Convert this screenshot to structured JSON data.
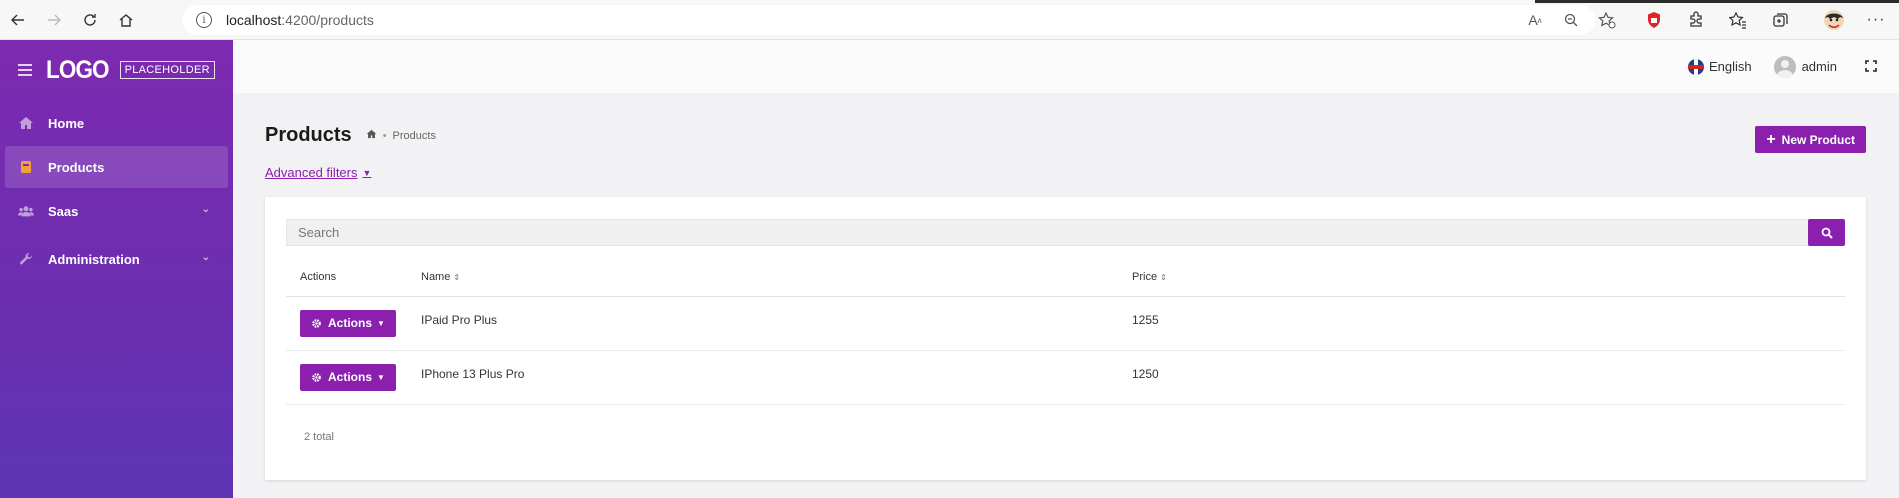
{
  "browser": {
    "url_host": "localhost",
    "url_path": ":4200/products"
  },
  "sidebar": {
    "logo": "LOGO",
    "logo_sub": "PLACEHOLDER",
    "items": [
      {
        "label": "Home",
        "icon": "home-icon"
      },
      {
        "label": "Products",
        "icon": "book-icon",
        "active": true
      },
      {
        "label": "Saas",
        "icon": "users-icon",
        "expandable": true
      },
      {
        "label": "Administration",
        "icon": "wrench-icon",
        "expandable": true
      }
    ]
  },
  "topbar": {
    "language": "English",
    "user": "admin"
  },
  "page": {
    "title": "Products",
    "breadcrumb": "Products",
    "new_button": "New Product",
    "advanced_filters": "Advanced filters"
  },
  "search": {
    "placeholder": "Search"
  },
  "table": {
    "headers": {
      "actions": "Actions",
      "name": "Name",
      "price": "Price"
    },
    "rows": [
      {
        "action": "Actions",
        "name": "IPaid Pro Plus",
        "price": "1255"
      },
      {
        "action": "Actions",
        "name": "IPhone 13 Plus Pro",
        "price": "1250"
      }
    ],
    "total": "2 total"
  },
  "colors": {
    "accent": "#8b1fae",
    "sidebar_top": "#7d2ab0",
    "sidebar_bottom": "#5d35b4"
  }
}
